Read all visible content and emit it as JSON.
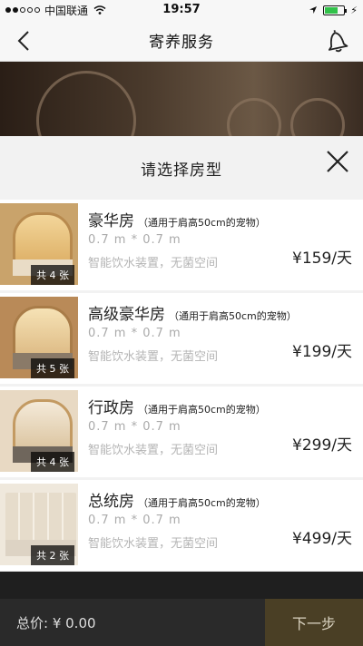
{
  "status_bar": {
    "carrier": "中国联通",
    "time": "19:57",
    "battery_level": 0.7,
    "icons": [
      "signal-icon",
      "wifi-icon",
      "location-arrow-icon",
      "battery-icon",
      "charging-bolt-icon"
    ]
  },
  "nav": {
    "title": "寄养服务",
    "back_icon": "back-chevron-icon",
    "bell_icon": "bell-icon"
  },
  "sheet": {
    "title": "请选择房型",
    "close_icon": "close-icon"
  },
  "rooms": [
    {
      "name": "豪华房",
      "note": "（通用于肩高50cm的宠物）",
      "size": "0.7 m * 0.7 m",
      "feature": "智能饮水装置，无菌空间",
      "price": "¥159/天",
      "count": "共 4 张"
    },
    {
      "name": "高级豪华房",
      "note": "（通用于肩高50cm的宠物）",
      "size": "0.7 m * 0.7 m",
      "feature": "智能饮水装置，无菌空间",
      "price": "¥199/天",
      "count": "共 5 张"
    },
    {
      "name": "行政房",
      "note": "（通用于肩高50cm的宠物）",
      "size": "0.7 m * 0.7 m",
      "feature": "智能饮水装置，无菌空间",
      "price": "¥299/天",
      "count": "共 4 张"
    },
    {
      "name": "总统房",
      "note": "（通用于肩高50cm的宠物）",
      "size": "0.7 m * 0.7 m",
      "feature": "智能饮水装置，无菌空间",
      "price": "¥499/天",
      "count": "共 2 张"
    }
  ],
  "footer": {
    "total_label": "总价: ¥ 0.00",
    "next_label": "下一步"
  },
  "colors": {
    "accent_dark_gold": "#4a3f25",
    "battery_green": "#31c24a"
  }
}
